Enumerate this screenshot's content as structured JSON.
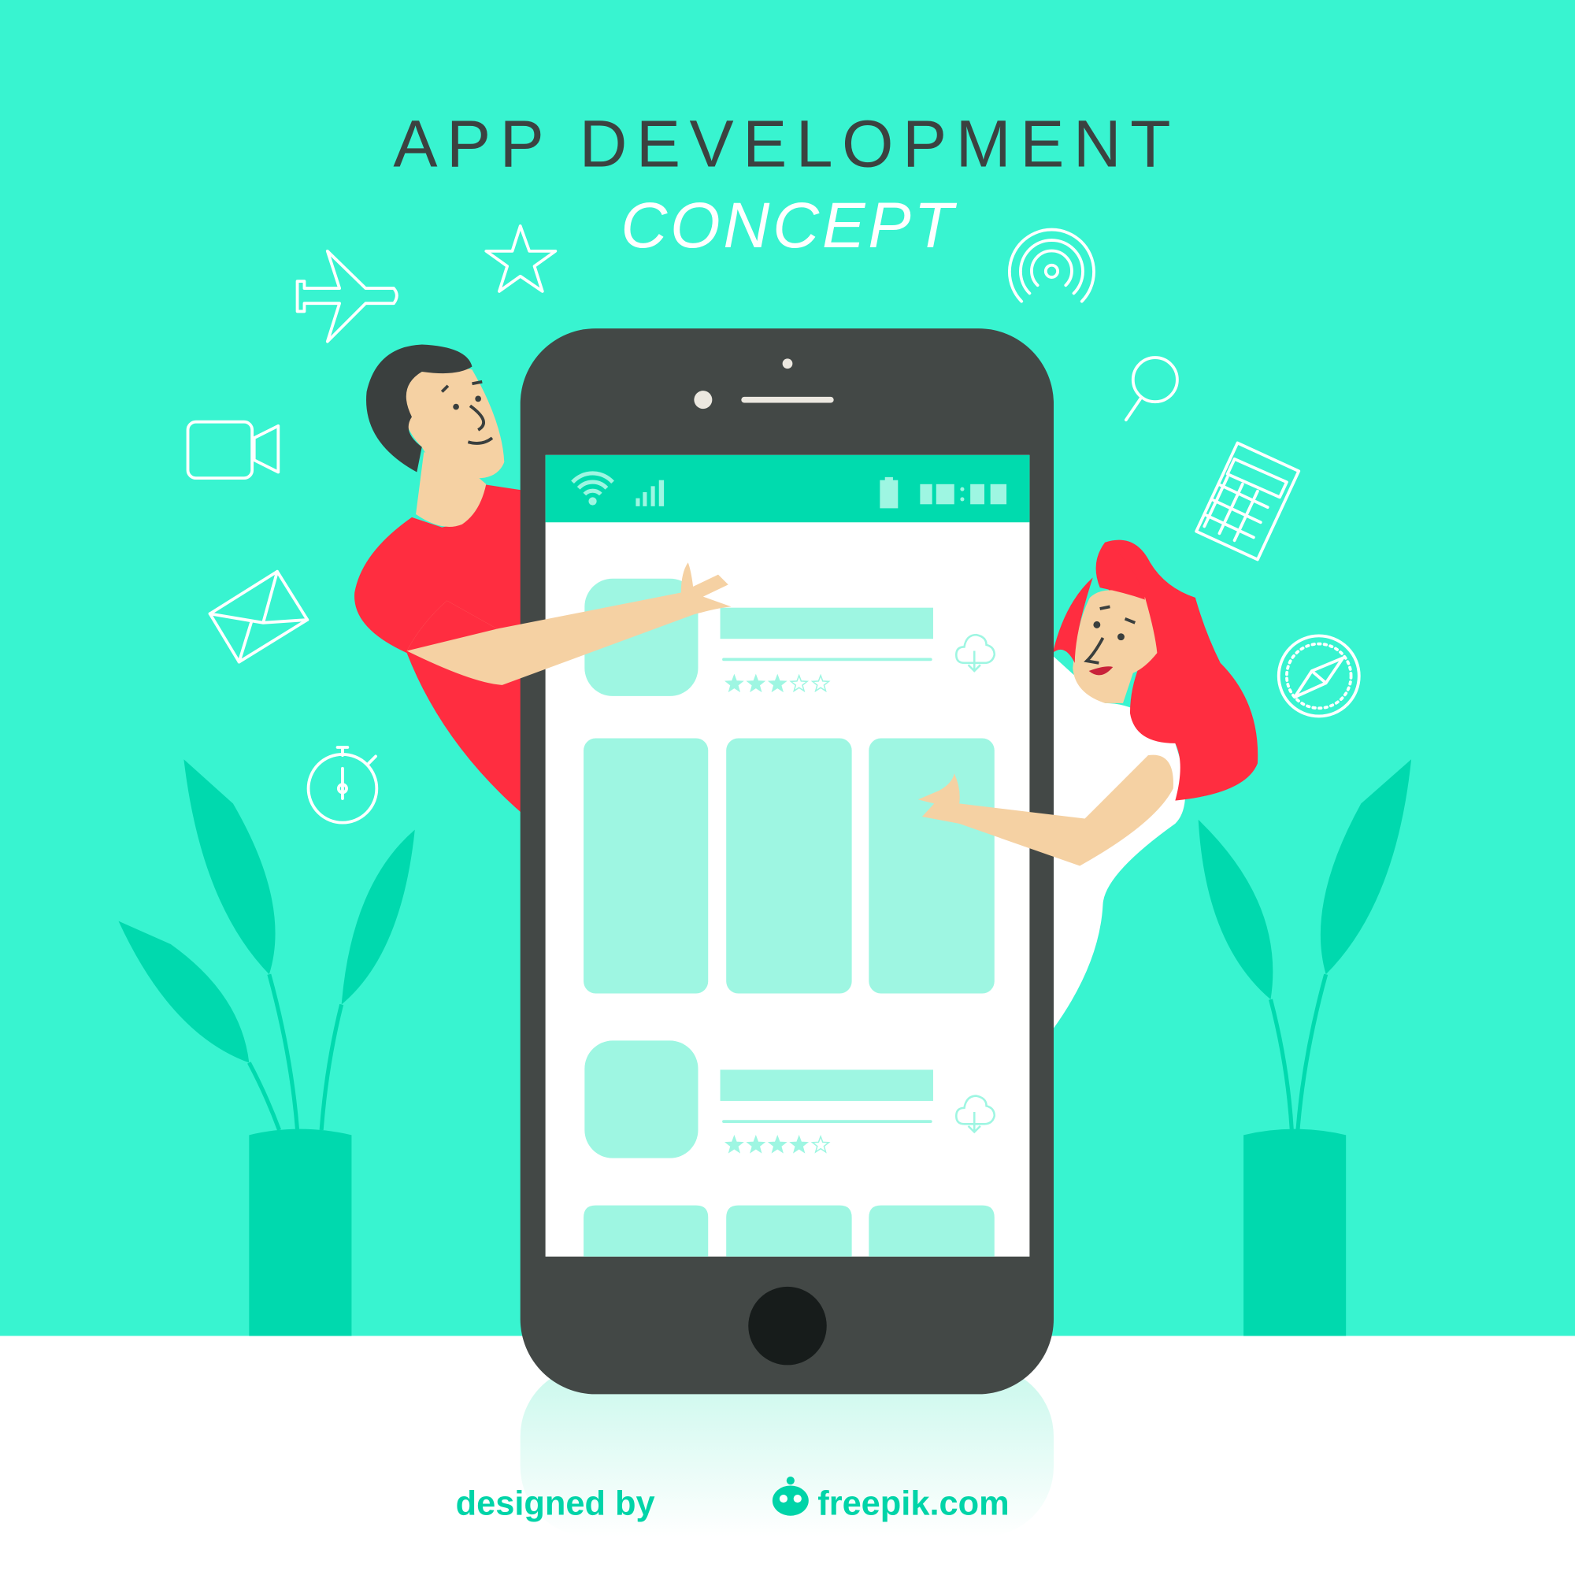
{
  "title": {
    "line1": "APP DEVELOPMENT",
    "line2": "CONCEPT"
  },
  "credit": {
    "prefix": "designed by",
    "brand": "freepik.com"
  },
  "colors": {
    "background": "#38F4D0",
    "accent": "#00DBAE",
    "light_accent": "#9EF6E2",
    "phone": "#434846",
    "shirt_red": "#FF2D40",
    "skin": "#F5D1A3"
  },
  "phone_screen": {
    "status_icons": [
      "wifi-icon",
      "signal-icon",
      "battery-icon",
      "clock-icon"
    ],
    "apps": [
      {
        "rating": 3,
        "max_rating": 5,
        "action_icon": "cloud-download-icon"
      },
      {
        "rating": 4,
        "max_rating": 5,
        "action_icon": "cloud-download-icon"
      }
    ]
  },
  "floating_icons": [
    "airplane-icon",
    "star-icon",
    "video-camera-icon",
    "envelope-icon",
    "stopwatch-icon",
    "broadcast-icon",
    "magnifier-icon",
    "calculator-icon",
    "compass-icon"
  ]
}
